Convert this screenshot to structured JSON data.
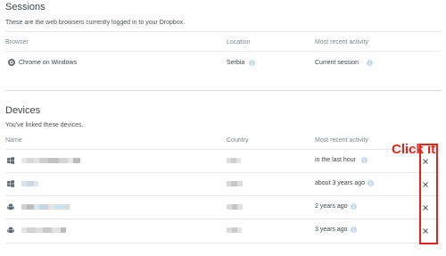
{
  "sessions": {
    "title": "Sessions",
    "subtitle": "These are the web browsers currently logged in to your Dropbox.",
    "columns": {
      "browser": "Browser",
      "location": "Location",
      "activity": "Most recent activity"
    },
    "rows": [
      {
        "browser": "Chrome on Windows",
        "location": "Serbia",
        "activity": "Current session"
      }
    ]
  },
  "devices": {
    "title": "Devices",
    "subtitle": "You've linked these devices.",
    "columns": {
      "name": "Name",
      "country": "Country",
      "activity": "Most recent activity"
    },
    "rows": [
      {
        "icon": "windows-icon",
        "activity": "in the last hour"
      },
      {
        "icon": "windows-icon",
        "activity": "about 3 years ago"
      },
      {
        "icon": "android-icon",
        "activity": "2 years ago"
      },
      {
        "icon": "android-icon",
        "activity": "3 years ago"
      }
    ]
  },
  "annotation": {
    "text": "Click it",
    "color": "#e1251b"
  },
  "icons": {
    "info": "info-icon",
    "remove": "close-icon",
    "browser": "chrome-icon"
  },
  "colors": {
    "info": "#c4d9ee",
    "annotation": "#e1251b",
    "text": "#3d464d",
    "muted": "#7b8994"
  }
}
